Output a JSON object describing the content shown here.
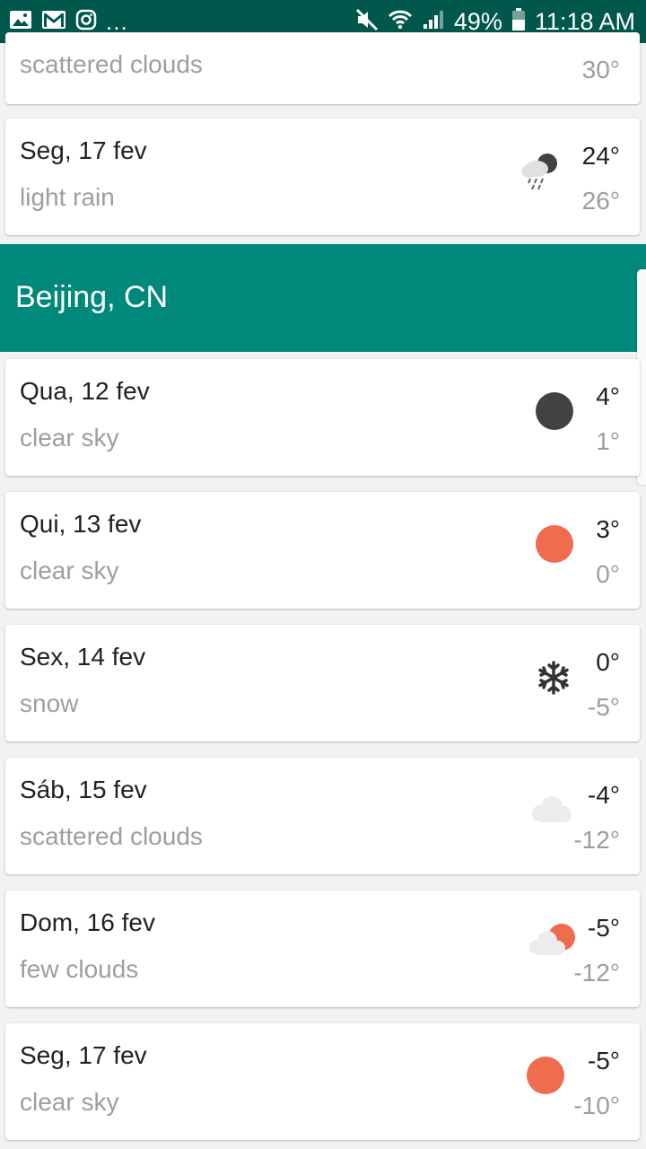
{
  "status_bar": {
    "overflow": "...",
    "battery": "49%",
    "time": "11:18 AM"
  },
  "prev_city": {
    "partial_card": {
      "desc": "scattered clouds",
      "temp_min": "30°",
      "icon": "cloud-icon"
    },
    "last_card": {
      "date": "Seg, 17 fev",
      "desc": "light rain",
      "temp_max": "24°",
      "temp_min": "26°",
      "icon": "rain-night-icon"
    }
  },
  "city": {
    "name": "Beijing, CN",
    "days": [
      {
        "date": "Qua, 12 fev",
        "desc": "clear sky",
        "temp_max": "4°",
        "temp_min": "1°",
        "icon": "clear-night-icon"
      },
      {
        "date": "Qui, 13 fev",
        "desc": "clear sky",
        "temp_max": "3°",
        "temp_min": "0°",
        "icon": "sun-icon"
      },
      {
        "date": "Sex, 14 fev",
        "desc": "snow",
        "temp_max": "0°",
        "temp_min": "-5°",
        "icon": "snowflake-icon"
      },
      {
        "date": "Sáb, 15 fev",
        "desc": "scattered clouds",
        "temp_max": "-4°",
        "temp_min": "-12°",
        "icon": "cloud-icon"
      },
      {
        "date": "Dom, 16 fev",
        "desc": "few clouds",
        "temp_max": "-5°",
        "temp_min": "-12°",
        "icon": "few-clouds-icon"
      },
      {
        "date": "Seg, 17 fev",
        "desc": "clear sky",
        "temp_max": "-5°",
        "temp_min": "-10°",
        "icon": "sun-icon"
      }
    ]
  },
  "colors": {
    "status_bar": "#00574b",
    "header": "#00897b",
    "sun": "#ef6c4f",
    "night": "#424242"
  }
}
